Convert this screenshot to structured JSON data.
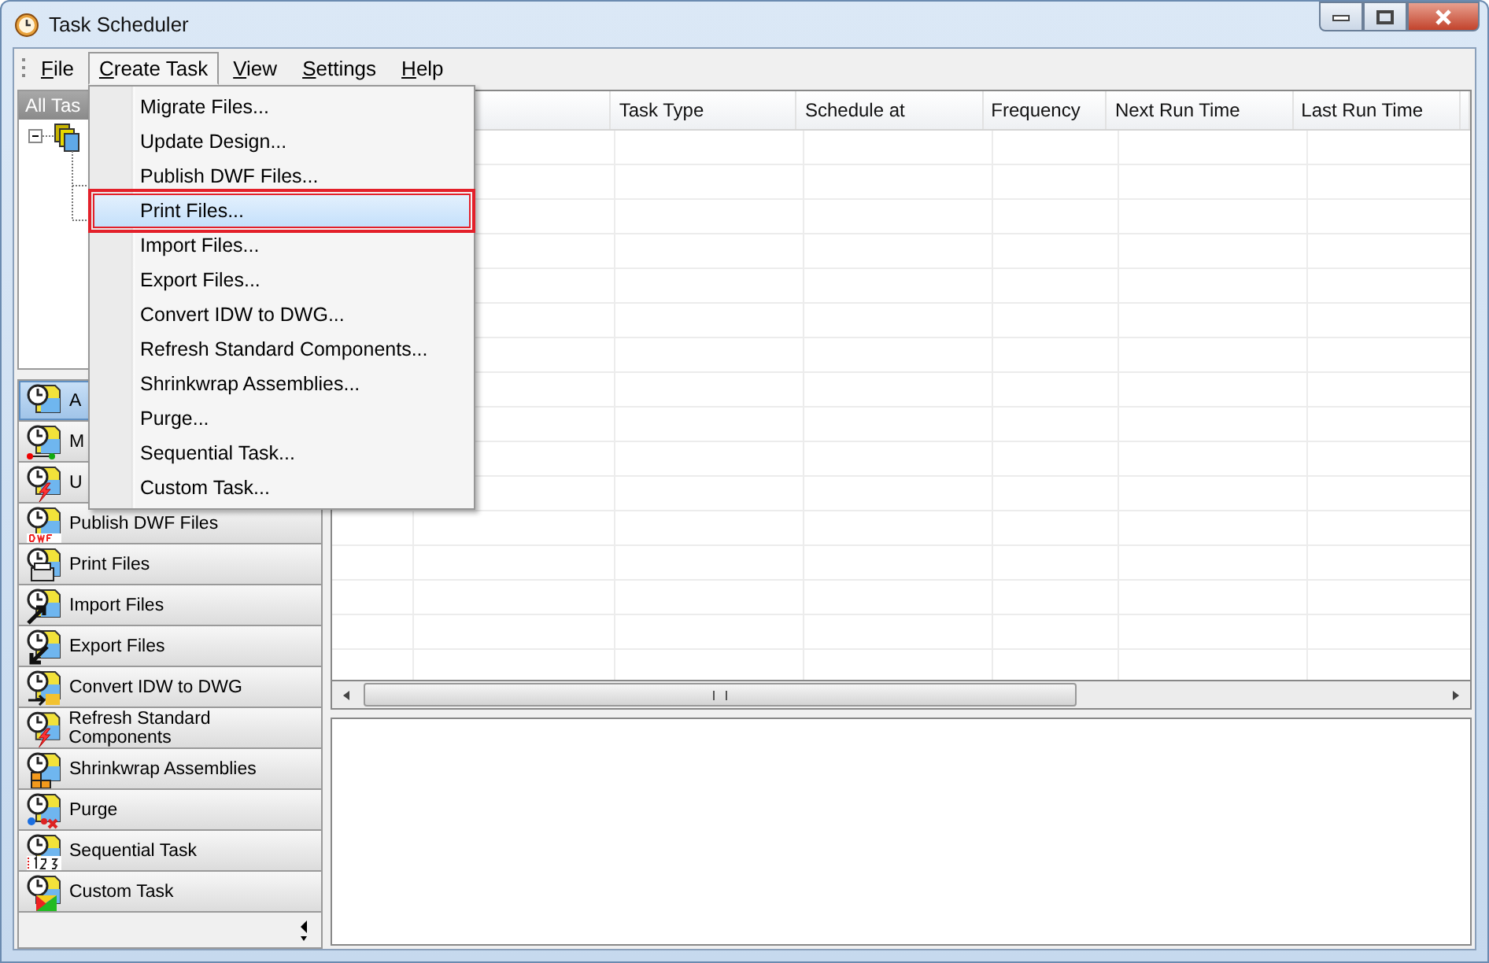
{
  "window": {
    "title": "Task Scheduler"
  },
  "menu_bar": [
    {
      "label": "File",
      "selected": false
    },
    {
      "label": "Create Task",
      "selected": true
    },
    {
      "label": "View",
      "selected": false
    },
    {
      "label": "Settings",
      "selected": false
    },
    {
      "label": "Help",
      "selected": false
    }
  ],
  "open_menu": {
    "items": [
      {
        "label": "Migrate Files...",
        "selected": false,
        "outlined": false
      },
      {
        "label": "Update Design...",
        "selected": false,
        "outlined": false
      },
      {
        "label": "Publish DWF Files...",
        "selected": false,
        "outlined": false
      },
      {
        "label": "Print Files...",
        "selected": true,
        "outlined": true
      },
      {
        "label": "Import Files...",
        "selected": false,
        "outlined": false
      },
      {
        "label": "Export Files...",
        "selected": false,
        "outlined": false
      },
      {
        "label": "Convert IDW to DWG...",
        "selected": false,
        "outlined": false
      },
      {
        "label": "Refresh Standard Components...",
        "selected": false,
        "outlined": false
      },
      {
        "label": "Shrinkwrap Assemblies...",
        "selected": false,
        "outlined": false
      },
      {
        "label": "Purge...",
        "selected": false,
        "outlined": false
      },
      {
        "label": "Sequential Task...",
        "selected": false,
        "outlined": false
      },
      {
        "label": "Custom Task...",
        "selected": false,
        "outlined": false
      }
    ]
  },
  "tree": {
    "header": "All Tas",
    "root": {
      "expanded": true
    }
  },
  "task_buttons": [
    {
      "label": "A",
      "selected": true
    },
    {
      "label": "M",
      "selected": false
    },
    {
      "label": "U",
      "selected": false
    },
    {
      "label": "Publish DWF Files",
      "selected": false
    },
    {
      "label": "Print Files",
      "selected": false
    },
    {
      "label": "Import Files",
      "selected": false
    },
    {
      "label": "Export Files",
      "selected": false
    },
    {
      "label": "Convert IDW to DWG",
      "selected": false
    },
    {
      "label": "Refresh Standard Components",
      "selected": false
    },
    {
      "label": "Shrinkwrap Assemblies",
      "selected": false
    },
    {
      "label": "Purge",
      "selected": false
    },
    {
      "label": "Sequential Task",
      "selected": false
    },
    {
      "label": "Custom Task",
      "selected": false
    }
  ],
  "table": {
    "columns": [
      {
        "label": "Task Type"
      },
      {
        "label": "Schedule at"
      },
      {
        "label": "Frequency"
      },
      {
        "label": "Next Run Time"
      },
      {
        "label": "Last Run Time"
      }
    ]
  }
}
